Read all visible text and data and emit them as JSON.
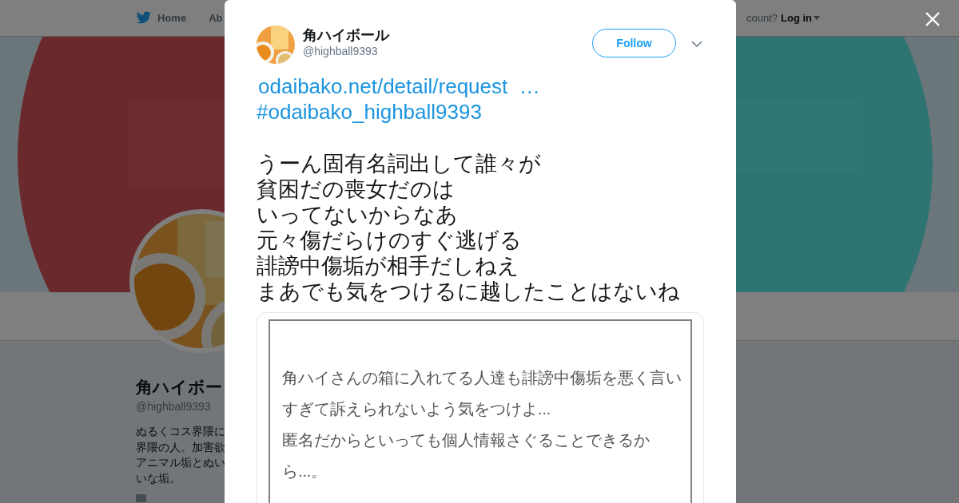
{
  "header": {
    "nav": [
      {
        "kind": "home",
        "label": "Home"
      },
      {
        "kind": "plain",
        "label": "Ab"
      }
    ],
    "login_prompt": "count?",
    "login": "Log in"
  },
  "profile": {
    "name": "角ハイボー",
    "handle": "@highball9393",
    "bio": [
      "ぬるくコス界隈に",
      "界隈の人。加害欲",
      "アニマル垢とぬい",
      "いな垢。"
    ]
  },
  "tweet": {
    "author": {
      "name": "角ハイボール",
      "handle": "@highball9393"
    },
    "follow_button": "Follow",
    "link": "odaibako.net/detail/request  …",
    "hashtag": "#odaibako_highball9393",
    "text_lines": [
      "うーん固有名詞出して誰々が",
      "貧困だの喪女だのは",
      "いってないからなあ",
      "元々傷だらけのすぐ逃げる",
      "誹謗中傷垢が相手だしねえ",
      "まあでも気をつけるに越したことはないね"
    ],
    "card": {
      "lines": [
        "角ハイさんの箱に入れてる人達も誹謗中傷垢を悪く言い",
        "すぎて訴えられないよう気をつけよ...",
        "匿名だからといっても個人情報さぐることできるか",
        "ら...。"
      ]
    }
  }
}
